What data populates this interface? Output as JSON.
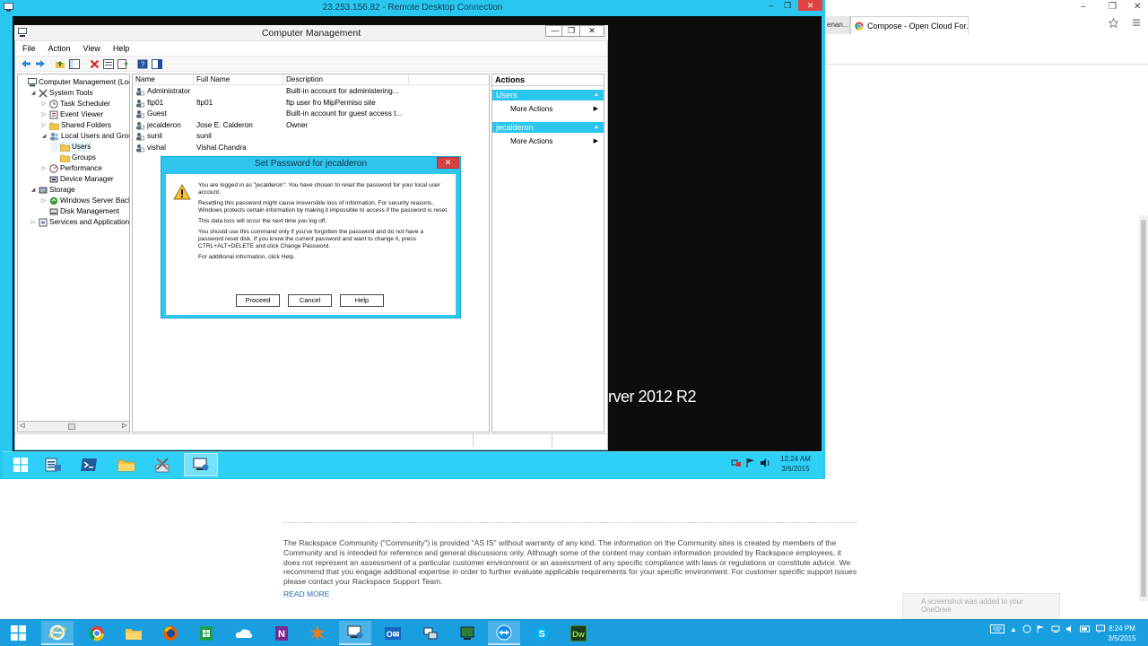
{
  "host": {
    "prev_tab_label": "enan...",
    "tab_label": "Compose - Open Cloud For...",
    "tab_close": "✕",
    "window_controls": [
      "–",
      "❐",
      "✕"
    ],
    "footer_text": "The Rackspace Community (\"Community\") is provided \"AS IS\" without warranty of any kind. The information on the Community sites is created by members of the Community and is intended for reference and general discussions only. Although some of the content may contain information provided by Rackspace employees, it does not represent an assessment of a particular customer environment or an assessment of any specific compliance with laws or regulations or constitute advice. We recommend that you engage additional expertise in order to further evaluate applicable requirements for your specific environment. For customer specific support issues please contact your Rackspace Support Team.",
    "read_more": "READ MORE",
    "notification_text": "A screenshot was added to your OneDrive",
    "clock_time": "8:24 PM",
    "clock_date": "3/5/2015"
  },
  "rdp": {
    "title": "23.253.156.82 - Remote Desktop Connection",
    "controls": [
      "–",
      "❐",
      "✕"
    ],
    "brand_text": "rver 2012 R2",
    "clock_time": "12:24 AM",
    "clock_date": "3/6/2015"
  },
  "cm": {
    "title": "Computer Management",
    "controls": [
      "—",
      "❐",
      "✕"
    ],
    "menu": [
      "File",
      "Action",
      "View",
      "Help"
    ],
    "tree": [
      {
        "label": "Computer Management (Local",
        "indent": 0,
        "exp": "",
        "icon": "computer-icon"
      },
      {
        "label": "System Tools",
        "indent": 1,
        "exp": "◢",
        "icon": "tools-icon"
      },
      {
        "label": "Task Scheduler",
        "indent": 2,
        "exp": "▷",
        "icon": "clock-icon"
      },
      {
        "label": "Event Viewer",
        "indent": 2,
        "exp": "▷",
        "icon": "event-icon"
      },
      {
        "label": "Shared Folders",
        "indent": 2,
        "exp": "▷",
        "icon": "folder-icon"
      },
      {
        "label": "Local Users and Groups",
        "indent": 2,
        "exp": "◢",
        "icon": "users-icon"
      },
      {
        "label": "Users",
        "indent": 3,
        "exp": "",
        "icon": "folder-icon"
      },
      {
        "label": "Groups",
        "indent": 3,
        "exp": "",
        "icon": "folder-icon"
      },
      {
        "label": "Performance",
        "indent": 2,
        "exp": "▷",
        "icon": "performance-icon"
      },
      {
        "label": "Device Manager",
        "indent": 2,
        "exp": "",
        "icon": "device-icon"
      },
      {
        "label": "Storage",
        "indent": 1,
        "exp": "◢",
        "icon": "storage-icon"
      },
      {
        "label": "Windows Server Backup",
        "indent": 2,
        "exp": "▷",
        "icon": "backup-icon"
      },
      {
        "label": "Disk Management",
        "indent": 2,
        "exp": "",
        "icon": "disk-icon"
      },
      {
        "label": "Services and Applications",
        "indent": 1,
        "exp": "▷",
        "icon": "services-icon"
      }
    ],
    "columns": [
      "Name",
      "Full Name",
      "Description"
    ],
    "users": [
      {
        "name": "Administrator",
        "full_name": "",
        "description": "Built-in account for administering..."
      },
      {
        "name": "ftp01",
        "full_name": "ftp01",
        "description": "ftp user fro MipPermiso site"
      },
      {
        "name": "Guest",
        "full_name": "",
        "description": "Built-in account for guest access t..."
      },
      {
        "name": "jecalderon",
        "full_name": "Jose E. Calderon",
        "description": "Owner"
      },
      {
        "name": "sunil",
        "full_name": "sunil",
        "description": ""
      },
      {
        "name": "vishal",
        "full_name": "Vishal Chandra",
        "description": ""
      }
    ],
    "actions": {
      "header": "Actions",
      "groups": [
        {
          "title": "Users",
          "items": [
            "More Actions"
          ]
        },
        {
          "title": "jecalderon",
          "items": [
            "More Actions"
          ]
        }
      ]
    }
  },
  "dialog": {
    "title": "Set Password for jecalderon",
    "close": "✕",
    "paragraphs": [
      "You are logged in as \"jecalderon\". You have chosen to reset the password for your local user account.",
      "Resetting this password might cause irreversible loss of information. For security reasons, Windows protects certain information by making it impossible to access if the password is reset.",
      "This data loss will occur the next time you log off.",
      "You should use this command only if you've forgotten the password and do not have a password reset disk. If you know the current password and want to change it, press CTRL+ALT+DELETE and click Change Password.",
      "For additional information, click Help."
    ],
    "buttons": {
      "proceed": "Proceed",
      "cancel": "Cancel",
      "help": "Help"
    }
  },
  "colors": {
    "accent": "#2ec6ef",
    "taskbar_host": "#199ee0",
    "desktop": "#0d0d0d",
    "close_red": "#e04343"
  }
}
